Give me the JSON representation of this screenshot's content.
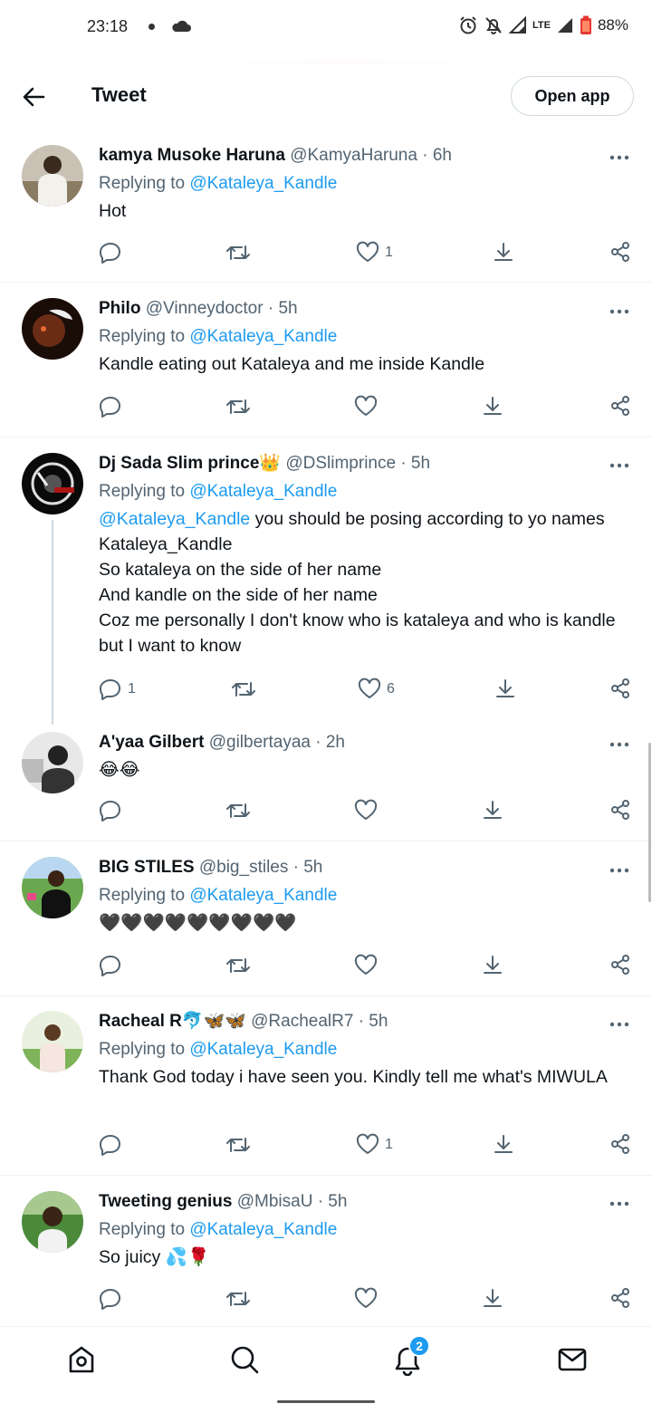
{
  "status_bar": {
    "time": "23:18",
    "lte": "LTE",
    "battery": "88%"
  },
  "header": {
    "title": "Tweet",
    "open_app": "Open app"
  },
  "tweets": [
    {
      "name": "kamya Musoke Haruna",
      "handle": "@KamyaHaruna · 6h",
      "replying_prefix": "Replying to ",
      "replying_to": "@Kataleya_Kandle",
      "text": "Hot",
      "replies": "",
      "retweets": "",
      "likes": "1"
    },
    {
      "name": "Philo",
      "handle": "@Vinneydoctor · 5h",
      "replying_prefix": "Replying to ",
      "replying_to": "@Kataleya_Kandle",
      "text": "Kandle eating out Kataleya and me inside Kandle",
      "replies": "",
      "retweets": "",
      "likes": ""
    },
    {
      "name": "Dj Sada Slim prince👑",
      "handle": "@DSlimprince · 5h",
      "replying_prefix": "Replying to ",
      "replying_to": "@Kataleya_Kandle",
      "text_mention": "@Kataleya_Kandle",
      "text": " you should be posing according to yo names\nKataleya_Kandle\nSo kataleya on the side of her name\nAnd kandle on the side of her name\nCoz me personally I don't know who is kataleya and who is kandle but I want to know",
      "replies": "1",
      "retweets": "",
      "likes": "6"
    },
    {
      "name": "A'yaa Gilbert",
      "handle": "@gilbertayaa · 2h",
      "text": "😂😂",
      "replies": "",
      "retweets": "",
      "likes": ""
    },
    {
      "name": "BIG STILES",
      "handle": "@big_stiles · 5h",
      "replying_prefix": "Replying to ",
      "replying_to": "@Kataleya_Kandle",
      "text": "🖤🖤🖤🖤🖤🖤🖤🖤🖤",
      "replies": "",
      "retweets": "",
      "likes": ""
    },
    {
      "name": "Racheal R🐬🦋🦋",
      "handle": "@RachealR7 · 5h",
      "replying_prefix": "Replying to ",
      "replying_to": "@Kataleya_Kandle",
      "text": "Thank God today i have seen you. Kindly tell me what's MIWULA",
      "replies": "",
      "retweets": "",
      "likes": "1"
    },
    {
      "name": "Tweeting genius",
      "handle": "@MbisaU · 5h",
      "replying_prefix": "Replying to ",
      "replying_to": "@Kataleya_Kandle",
      "text": "So juicy 💦🌹",
      "replies": "",
      "retweets": "",
      "likes": ""
    }
  ],
  "bottom_nav": {
    "notifications_badge": "2"
  },
  "icons": [
    "back-arrow-icon",
    "more-icon",
    "reply-icon",
    "retweet-icon",
    "like-icon",
    "bookmark-icon",
    "share-icon",
    "home-icon",
    "search-icon",
    "notifications-icon",
    "messages-icon"
  ],
  "colors": {
    "accent": "#1d9bf0",
    "secondary_text": "#536471"
  }
}
